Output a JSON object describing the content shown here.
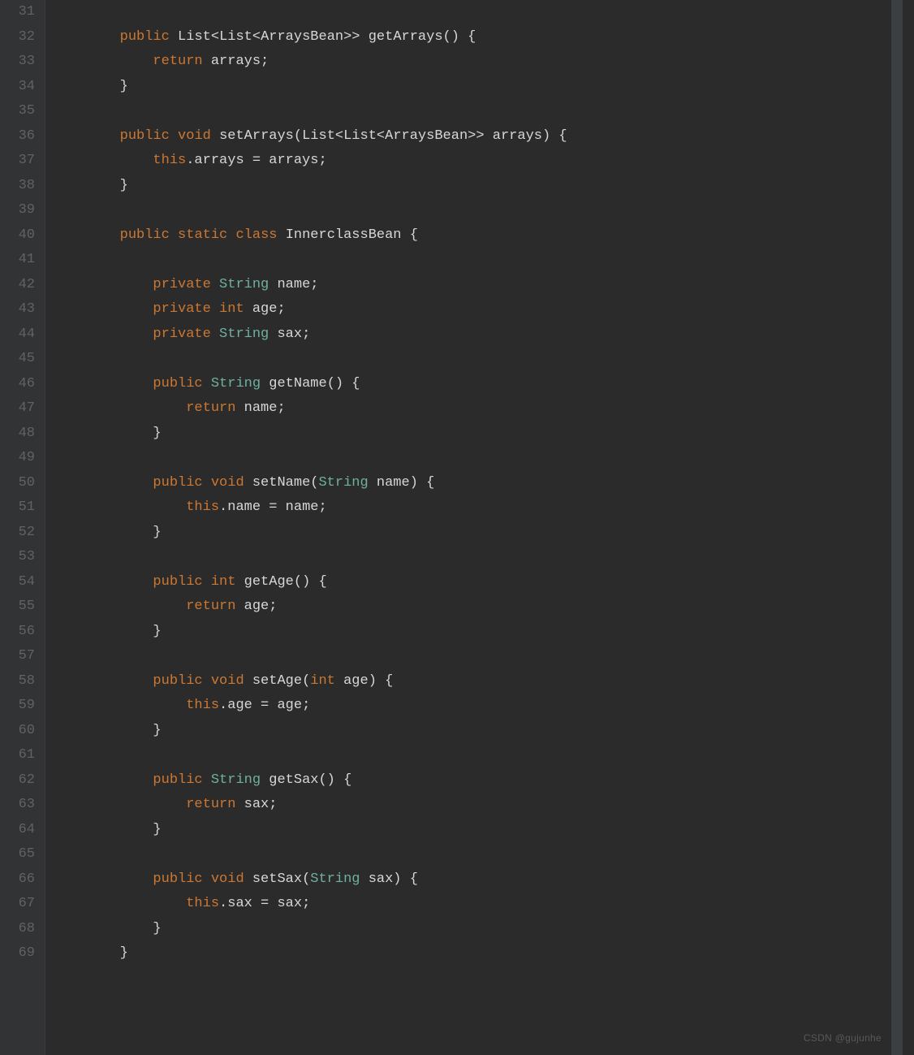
{
  "watermark": "CSDN @gujunhe",
  "gutter": {
    "start": 31,
    "end": 69
  },
  "code": {
    "lines": [
      {
        "n": 31,
        "tokens": []
      },
      {
        "n": 32,
        "indent": 2,
        "tokens": [
          {
            "t": "public",
            "c": "kw"
          },
          {
            "t": " "
          },
          {
            "t": "List",
            "c": "ident"
          },
          {
            "t": "<"
          },
          {
            "t": "List",
            "c": "ident"
          },
          {
            "t": "<"
          },
          {
            "t": "ArraysBean",
            "c": "ident"
          },
          {
            "t": ">> "
          },
          {
            "t": "getArrays",
            "c": "method"
          },
          {
            "t": "() {"
          }
        ]
      },
      {
        "n": 33,
        "indent": 3,
        "tokens": [
          {
            "t": "return",
            "c": "kw"
          },
          {
            "t": " arrays;"
          }
        ]
      },
      {
        "n": 34,
        "indent": 2,
        "tokens": [
          {
            "t": "}"
          }
        ]
      },
      {
        "n": 35,
        "tokens": []
      },
      {
        "n": 36,
        "indent": 2,
        "tokens": [
          {
            "t": "public",
            "c": "kw"
          },
          {
            "t": " "
          },
          {
            "t": "void",
            "c": "kw"
          },
          {
            "t": " "
          },
          {
            "t": "setArrays",
            "c": "method"
          },
          {
            "t": "("
          },
          {
            "t": "List",
            "c": "ident"
          },
          {
            "t": "<"
          },
          {
            "t": "List",
            "c": "ident"
          },
          {
            "t": "<"
          },
          {
            "t": "ArraysBean",
            "c": "ident"
          },
          {
            "t": ">> arrays) {"
          }
        ]
      },
      {
        "n": 37,
        "indent": 3,
        "tokens": [
          {
            "t": "this",
            "c": "kw"
          },
          {
            "t": ".arrays = arrays;"
          }
        ]
      },
      {
        "n": 38,
        "indent": 2,
        "tokens": [
          {
            "t": "}"
          }
        ]
      },
      {
        "n": 39,
        "tokens": []
      },
      {
        "n": 40,
        "indent": 2,
        "tokens": [
          {
            "t": "public",
            "c": "kw"
          },
          {
            "t": " "
          },
          {
            "t": "static",
            "c": "kw"
          },
          {
            "t": " "
          },
          {
            "t": "class",
            "c": "kw"
          },
          {
            "t": " "
          },
          {
            "t": "InnerclassBean",
            "c": "ident"
          },
          {
            "t": " {"
          }
        ]
      },
      {
        "n": 41,
        "tokens": []
      },
      {
        "n": 42,
        "indent": 3,
        "tokens": [
          {
            "t": "private",
            "c": "kw"
          },
          {
            "t": " "
          },
          {
            "t": "String",
            "c": "type"
          },
          {
            "t": " name;"
          }
        ]
      },
      {
        "n": 43,
        "indent": 3,
        "tokens": [
          {
            "t": "private",
            "c": "kw"
          },
          {
            "t": " "
          },
          {
            "t": "int",
            "c": "kw"
          },
          {
            "t": " age;"
          }
        ]
      },
      {
        "n": 44,
        "indent": 3,
        "tokens": [
          {
            "t": "private",
            "c": "kw"
          },
          {
            "t": " "
          },
          {
            "t": "String",
            "c": "type"
          },
          {
            "t": " sax;"
          }
        ]
      },
      {
        "n": 45,
        "tokens": []
      },
      {
        "n": 46,
        "indent": 3,
        "tokens": [
          {
            "t": "public",
            "c": "kw"
          },
          {
            "t": " "
          },
          {
            "t": "String",
            "c": "type"
          },
          {
            "t": " "
          },
          {
            "t": "getName",
            "c": "method"
          },
          {
            "t": "() {"
          }
        ]
      },
      {
        "n": 47,
        "indent": 4,
        "tokens": [
          {
            "t": "return",
            "c": "kw"
          },
          {
            "t": " name;"
          }
        ]
      },
      {
        "n": 48,
        "indent": 3,
        "tokens": [
          {
            "t": "}"
          }
        ]
      },
      {
        "n": 49,
        "tokens": []
      },
      {
        "n": 50,
        "indent": 3,
        "tokens": [
          {
            "t": "public",
            "c": "kw"
          },
          {
            "t": " "
          },
          {
            "t": "void",
            "c": "kw"
          },
          {
            "t": " "
          },
          {
            "t": "setName",
            "c": "method"
          },
          {
            "t": "("
          },
          {
            "t": "String",
            "c": "type"
          },
          {
            "t": " name) {"
          }
        ]
      },
      {
        "n": 51,
        "indent": 4,
        "tokens": [
          {
            "t": "this",
            "c": "kw"
          },
          {
            "t": ".name = name;"
          }
        ]
      },
      {
        "n": 52,
        "indent": 3,
        "tokens": [
          {
            "t": "}"
          }
        ]
      },
      {
        "n": 53,
        "tokens": []
      },
      {
        "n": 54,
        "indent": 3,
        "tokens": [
          {
            "t": "public",
            "c": "kw"
          },
          {
            "t": " "
          },
          {
            "t": "int",
            "c": "kw"
          },
          {
            "t": " "
          },
          {
            "t": "getAge",
            "c": "method"
          },
          {
            "t": "() {"
          }
        ]
      },
      {
        "n": 55,
        "indent": 4,
        "tokens": [
          {
            "t": "return",
            "c": "kw"
          },
          {
            "t": " age;"
          }
        ]
      },
      {
        "n": 56,
        "indent": 3,
        "tokens": [
          {
            "t": "}"
          }
        ]
      },
      {
        "n": 57,
        "tokens": []
      },
      {
        "n": 58,
        "indent": 3,
        "tokens": [
          {
            "t": "public",
            "c": "kw"
          },
          {
            "t": " "
          },
          {
            "t": "void",
            "c": "kw"
          },
          {
            "t": " "
          },
          {
            "t": "setAge",
            "c": "method"
          },
          {
            "t": "("
          },
          {
            "t": "int",
            "c": "kw"
          },
          {
            "t": " age) {"
          }
        ]
      },
      {
        "n": 59,
        "indent": 4,
        "tokens": [
          {
            "t": "this",
            "c": "kw"
          },
          {
            "t": ".age = age;"
          }
        ]
      },
      {
        "n": 60,
        "indent": 3,
        "tokens": [
          {
            "t": "}"
          }
        ]
      },
      {
        "n": 61,
        "tokens": []
      },
      {
        "n": 62,
        "indent": 3,
        "tokens": [
          {
            "t": "public",
            "c": "kw"
          },
          {
            "t": " "
          },
          {
            "t": "String",
            "c": "type"
          },
          {
            "t": " "
          },
          {
            "t": "getSax",
            "c": "method"
          },
          {
            "t": "() {"
          }
        ]
      },
      {
        "n": 63,
        "indent": 4,
        "tokens": [
          {
            "t": "return",
            "c": "kw"
          },
          {
            "t": " sax;"
          }
        ]
      },
      {
        "n": 64,
        "indent": 3,
        "tokens": [
          {
            "t": "}"
          }
        ]
      },
      {
        "n": 65,
        "tokens": []
      },
      {
        "n": 66,
        "indent": 3,
        "tokens": [
          {
            "t": "public",
            "c": "kw"
          },
          {
            "t": " "
          },
          {
            "t": "void",
            "c": "kw"
          },
          {
            "t": " "
          },
          {
            "t": "setSax",
            "c": "method"
          },
          {
            "t": "("
          },
          {
            "t": "String",
            "c": "type"
          },
          {
            "t": " sax) {"
          }
        ]
      },
      {
        "n": 67,
        "indent": 4,
        "tokens": [
          {
            "t": "this",
            "c": "kw"
          },
          {
            "t": ".sax = sax;"
          }
        ]
      },
      {
        "n": 68,
        "indent": 3,
        "tokens": [
          {
            "t": "}"
          }
        ]
      },
      {
        "n": 69,
        "indent": 2,
        "tokens": [
          {
            "t": "}"
          }
        ]
      }
    ]
  }
}
